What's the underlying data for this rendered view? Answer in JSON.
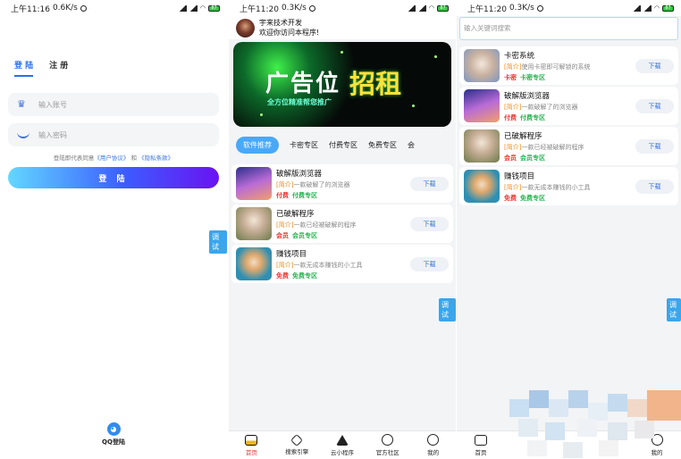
{
  "screen1": {
    "status": {
      "time": "上午11:16",
      "speed": "0.6K/s",
      "battery": "87"
    },
    "tabs": [
      "登 陆",
      "注 册"
    ],
    "account_placeholder": "输入账号",
    "password_placeholder": "输入密码",
    "agreement": {
      "prefix": "登陆即代表同意",
      "user_agreement": "《用户协议》",
      "and": "和",
      "privacy": "《隐私条款》"
    },
    "login_button": "登 陆",
    "debug_label": "调试",
    "qq_login": "QQ登陆"
  },
  "screen2": {
    "status": {
      "time": "上午11:20",
      "speed": "0.3K/s",
      "battery": "87"
    },
    "header": {
      "name": "宇来技术开发",
      "welcome": "欢迎你访问本程序!"
    },
    "banner": {
      "ad": "广告位",
      "hire": "招租",
      "sub": "全方位精准帮您推广"
    },
    "categories": [
      "软件推荐",
      "卡密专区",
      "付费专区",
      "免费专区",
      "会"
    ],
    "items": [
      {
        "title": "破解版浏览器",
        "intro": "[简介]",
        "desc": "一款破解了的浏览器",
        "tag1": "付费",
        "tag2": "付费专区"
      },
      {
        "title": "已破解程序",
        "intro": "[简介]",
        "desc": "一款已经被破解的程序",
        "tag1": "会员",
        "tag2": "会员专区"
      },
      {
        "title": "赚钱项目",
        "intro": "[简介]",
        "desc": "一款无成本赚钱的小工具",
        "tag1": "免费",
        "tag2": "免费专区"
      }
    ],
    "download_label": "下载",
    "debug_label": "调试",
    "nav": [
      "首页",
      "搜索引擎",
      "云小程序",
      "官方社区",
      "我的"
    ]
  },
  "screen3": {
    "status": {
      "time": "上午11:20",
      "speed": "0.3K/s",
      "battery": "87"
    },
    "search_placeholder": "输入关键词搜索",
    "items": [
      {
        "title": "卡密系统",
        "intro": "[简介]",
        "desc": "使用卡密即可解锁的系统",
        "tag1": "卡密",
        "tag2": "卡密专区"
      },
      {
        "title": "破解版浏览器",
        "intro": "[简介]",
        "desc": "一款破解了的浏览器",
        "tag1": "付费",
        "tag2": "付费专区"
      },
      {
        "title": "已破解程序",
        "intro": "[简介]",
        "desc": "一款已经被破解的程序",
        "tag1": "会员",
        "tag2": "会员专区"
      },
      {
        "title": "赚钱项目",
        "intro": "[简介]",
        "desc": "一款无成本赚钱的小工具",
        "tag1": "免费",
        "tag2": "免费专区"
      }
    ],
    "download_label": "下载",
    "debug_label": "调试",
    "nav": [
      "首页",
      "我的"
    ]
  },
  "colors": {
    "accent": "#2b6fe8",
    "red": "#e8342e",
    "green": "#23b14d",
    "orange": "#f08a1b"
  }
}
